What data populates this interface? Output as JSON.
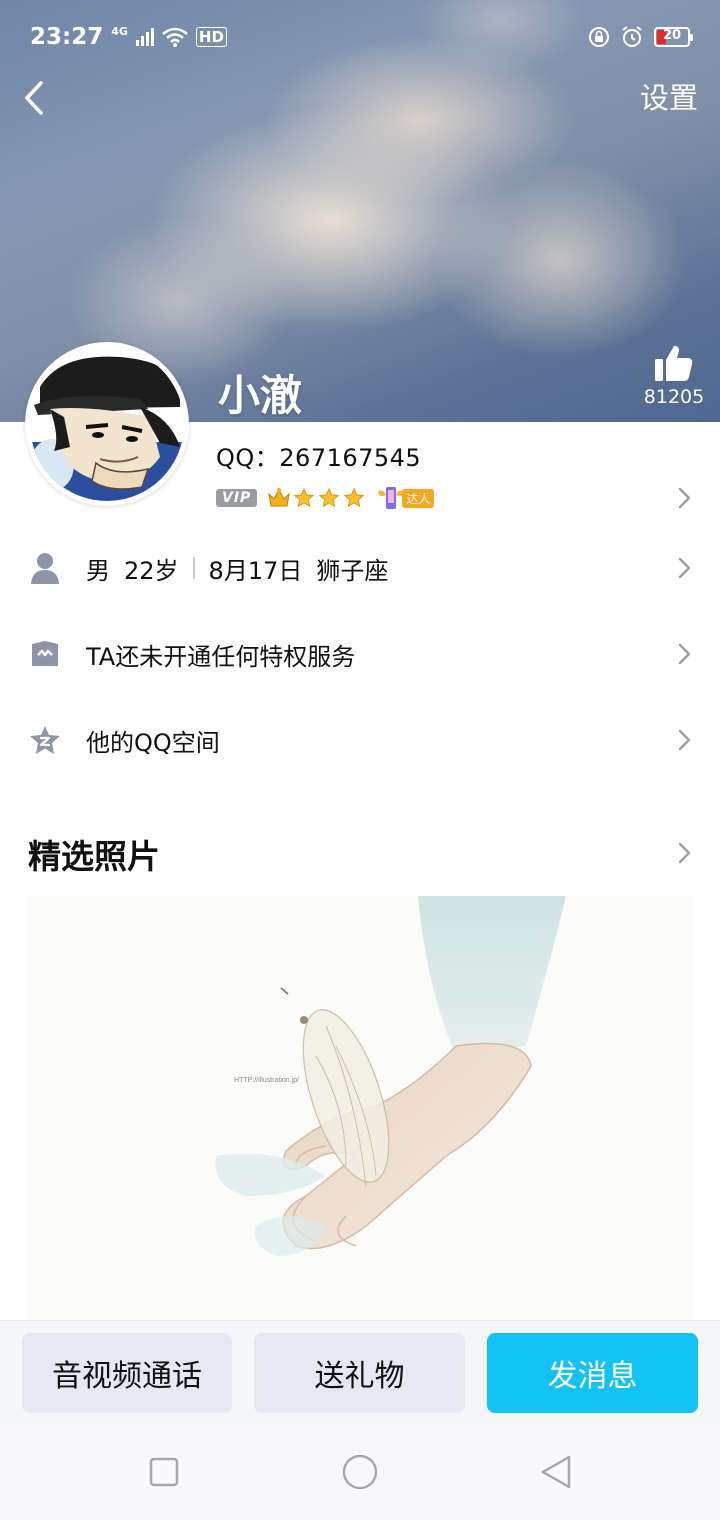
{
  "status_bar": {
    "time": "23:27",
    "network": "4G",
    "hd": "HD",
    "battery": "20"
  },
  "header": {
    "settings_label": "设置"
  },
  "profile": {
    "nickname": "小澈",
    "likes": "81205",
    "qq_line": "QQ：267167545",
    "vip_label": "VIP",
    "daren_label": "达人"
  },
  "info_rows": [
    {
      "gender": "男",
      "age": "22岁",
      "birthday": "8月17日",
      "sign": "狮子座"
    },
    {
      "label": "TA还未开通任何特权服务"
    },
    {
      "label": "他的QQ空间"
    }
  ],
  "photos": {
    "title": "精选照片",
    "watermark": "HTTP://illustration.jp/"
  },
  "actions": {
    "call_label": "音视频通话",
    "gift_label": "送礼物",
    "message_label": "发消息"
  },
  "colors": {
    "primary": "#12c2f2",
    "button_grey": "#e6e9f3",
    "icon_grey": "#8e95a8"
  }
}
